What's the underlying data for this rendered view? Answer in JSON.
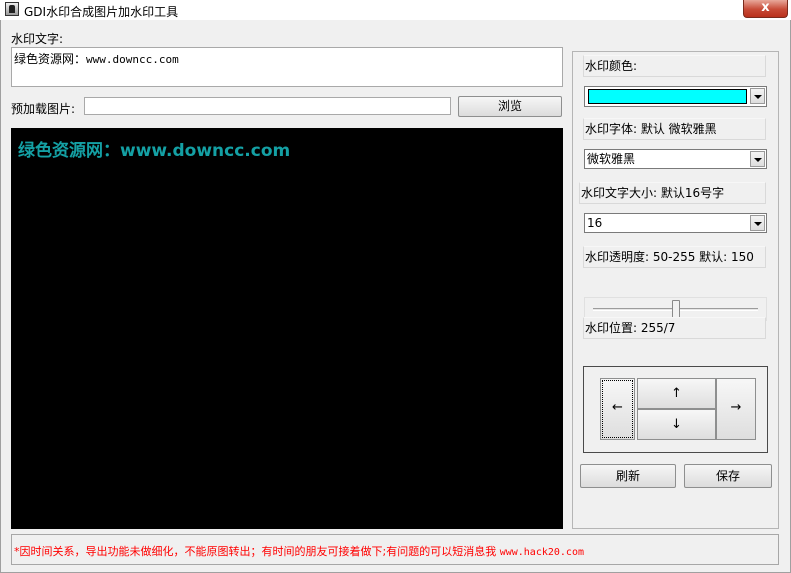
{
  "window": {
    "title": "GDI水印合成图片加水印工具",
    "close_glyph": "x"
  },
  "watermark_text": {
    "label": "水印文字:",
    "value_prefix": "绿色资源网：",
    "value_url": "www.downcc.com"
  },
  "preload_image": {
    "label": "预加载图片:",
    "value": "",
    "browse_label": "浏览"
  },
  "preview": {
    "rendered_text": "绿色资源网：www.downcc.com",
    "text_color": "#14a0a4",
    "background": "#000000"
  },
  "settings": {
    "color_label": "水印颜色:",
    "color_value": "#00ffff",
    "font_label": "水印字体: 默认 微软雅黑",
    "font_value": "微软雅黑",
    "size_label": "水印文字大小: 默认16号字",
    "size_value": "16",
    "opacity_label": "水印透明度: 50-255 默认: 150",
    "opacity_fraction": 0.5,
    "position_label": "水印位置: 255/7",
    "arrows": {
      "left": "←",
      "up": "↑",
      "down": "↓",
      "right": "→"
    },
    "refresh_label": "刷新",
    "save_label": "保存"
  },
  "status": {
    "message": "*因时间关系，导出功能未做细化，不能原图转出；有时间的朋友可接着做下;有问题的可以短消息我 ",
    "url": "www.hack20.com",
    "color": "#ff0000"
  }
}
